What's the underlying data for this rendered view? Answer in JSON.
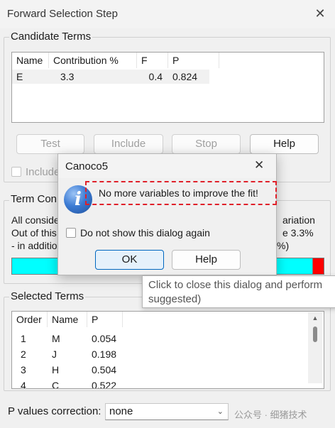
{
  "window": {
    "title": "Forward Selection Step",
    "close_glyph": "✕"
  },
  "candidate": {
    "group_label": "Candidate Terms",
    "columns": [
      "Name",
      "Contribution %",
      "F",
      "P"
    ],
    "row": {
      "name": "E",
      "contribution": "3.3",
      "f": "0.4",
      "p": "0.824"
    },
    "buttons": {
      "test": "Test",
      "include": "Include",
      "stop": "Stop",
      "help": "Help"
    },
    "include_checkbox_label": "Include"
  },
  "term_contribution": {
    "group_label_visible": "Term Con",
    "line1_left": "All conside",
    "line1_right": "ariation",
    "line2_left": "Out of this",
    "line2_right": "e 3.3%",
    "line3_left": "- in additio",
    "line3_right": "%)",
    "progress_colors": {
      "fill": "#00ffff",
      "end": "#ff0000"
    }
  },
  "selected": {
    "group_label": "Selected Terms",
    "columns": [
      "Order",
      "Name",
      "P"
    ],
    "rows": [
      {
        "order": "1",
        "name": "M",
        "p": "0.054"
      },
      {
        "order": "2",
        "name": "J",
        "p": "0.198"
      },
      {
        "order": "3",
        "name": "H",
        "p": "0.504"
      },
      {
        "order": "4",
        "name": "C",
        "p": "0.522"
      }
    ]
  },
  "footer": {
    "p_correction_label": "P values correction:",
    "p_correction_value": "none",
    "watermark": "公众号 · 细猪技术"
  },
  "dialog": {
    "title": "Canoco5",
    "close_glyph": "✕",
    "icon_glyph": "i",
    "message": "No more variables to improve the fit!",
    "checkbox_label": "Do not show this dialog again",
    "ok_label": "OK",
    "help_label": "Help",
    "highlight_color": "#e0202a"
  },
  "tooltip": {
    "line1": "Click to close this dialog and perform",
    "line2": "suggested)"
  }
}
